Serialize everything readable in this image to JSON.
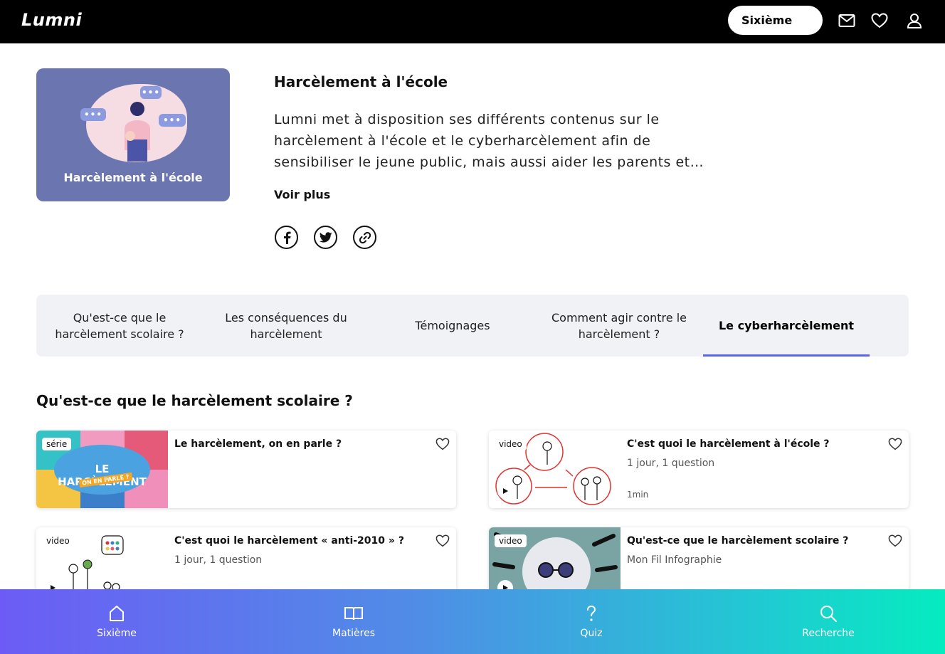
{
  "header": {
    "logo": "Lumni",
    "level_button": "Sixième",
    "icons": [
      "mail-icon",
      "heart-icon",
      "user-icon"
    ]
  },
  "hero": {
    "image_caption": "Harcèlement à l'école",
    "title": "Harcèlement à l'école",
    "description": "Lumni met à disposition ses différents contenus sur le harcèlement à l'école et le cyberharcèlement afin de sensibiliser le jeune public, mais aussi aider les parents et…",
    "voir_plus": "Voir plus",
    "share_icons": [
      "facebook-icon",
      "twitter-icon",
      "link-icon"
    ]
  },
  "tabs": [
    {
      "label": "Qu'est-ce que le harcèlement scolaire ?",
      "active": false
    },
    {
      "label": "Les conséquences du harcèlement",
      "active": false
    },
    {
      "label": "Témoignages",
      "active": false
    },
    {
      "label": "Comment agir contre le harcèlement ?",
      "active": false
    },
    {
      "label": "Le cyberharcèlement",
      "active": true
    }
  ],
  "section": {
    "title": "Qu'est-ce que le harcèlement scolaire ?"
  },
  "cards": [
    {
      "badge": "série",
      "title": "Le harcèlement, on en parle ?",
      "subtitle": "",
      "duration": "",
      "thumb_text": "LE HARCÈLEMENT",
      "thumb_sub": "ON EN PARLE ?"
    },
    {
      "badge": "video",
      "title": "C'est quoi le harcèlement à l'école ?",
      "subtitle": "1 jour, 1 question",
      "duration": "1min"
    },
    {
      "badge": "video",
      "title": "C'est quoi le harcèlement « anti-2010 » ?",
      "subtitle": "1 jour, 1 question",
      "duration": ""
    },
    {
      "badge": "video",
      "title": "Qu'est-ce que le harcèlement scolaire ?",
      "subtitle": "Mon Fil Infographie",
      "duration": ""
    }
  ],
  "bottom_nav": [
    {
      "label": "Sixième",
      "icon": "home-icon"
    },
    {
      "label": "Matières",
      "icon": "book-icon"
    },
    {
      "label": "Quiz",
      "icon": "question-icon"
    },
    {
      "label": "Recherche",
      "icon": "search-icon"
    }
  ],
  "colors": {
    "accent": "#5b67e8",
    "hero_bg": "#6b75b0",
    "tabs_bg": "#f1f2f6"
  }
}
